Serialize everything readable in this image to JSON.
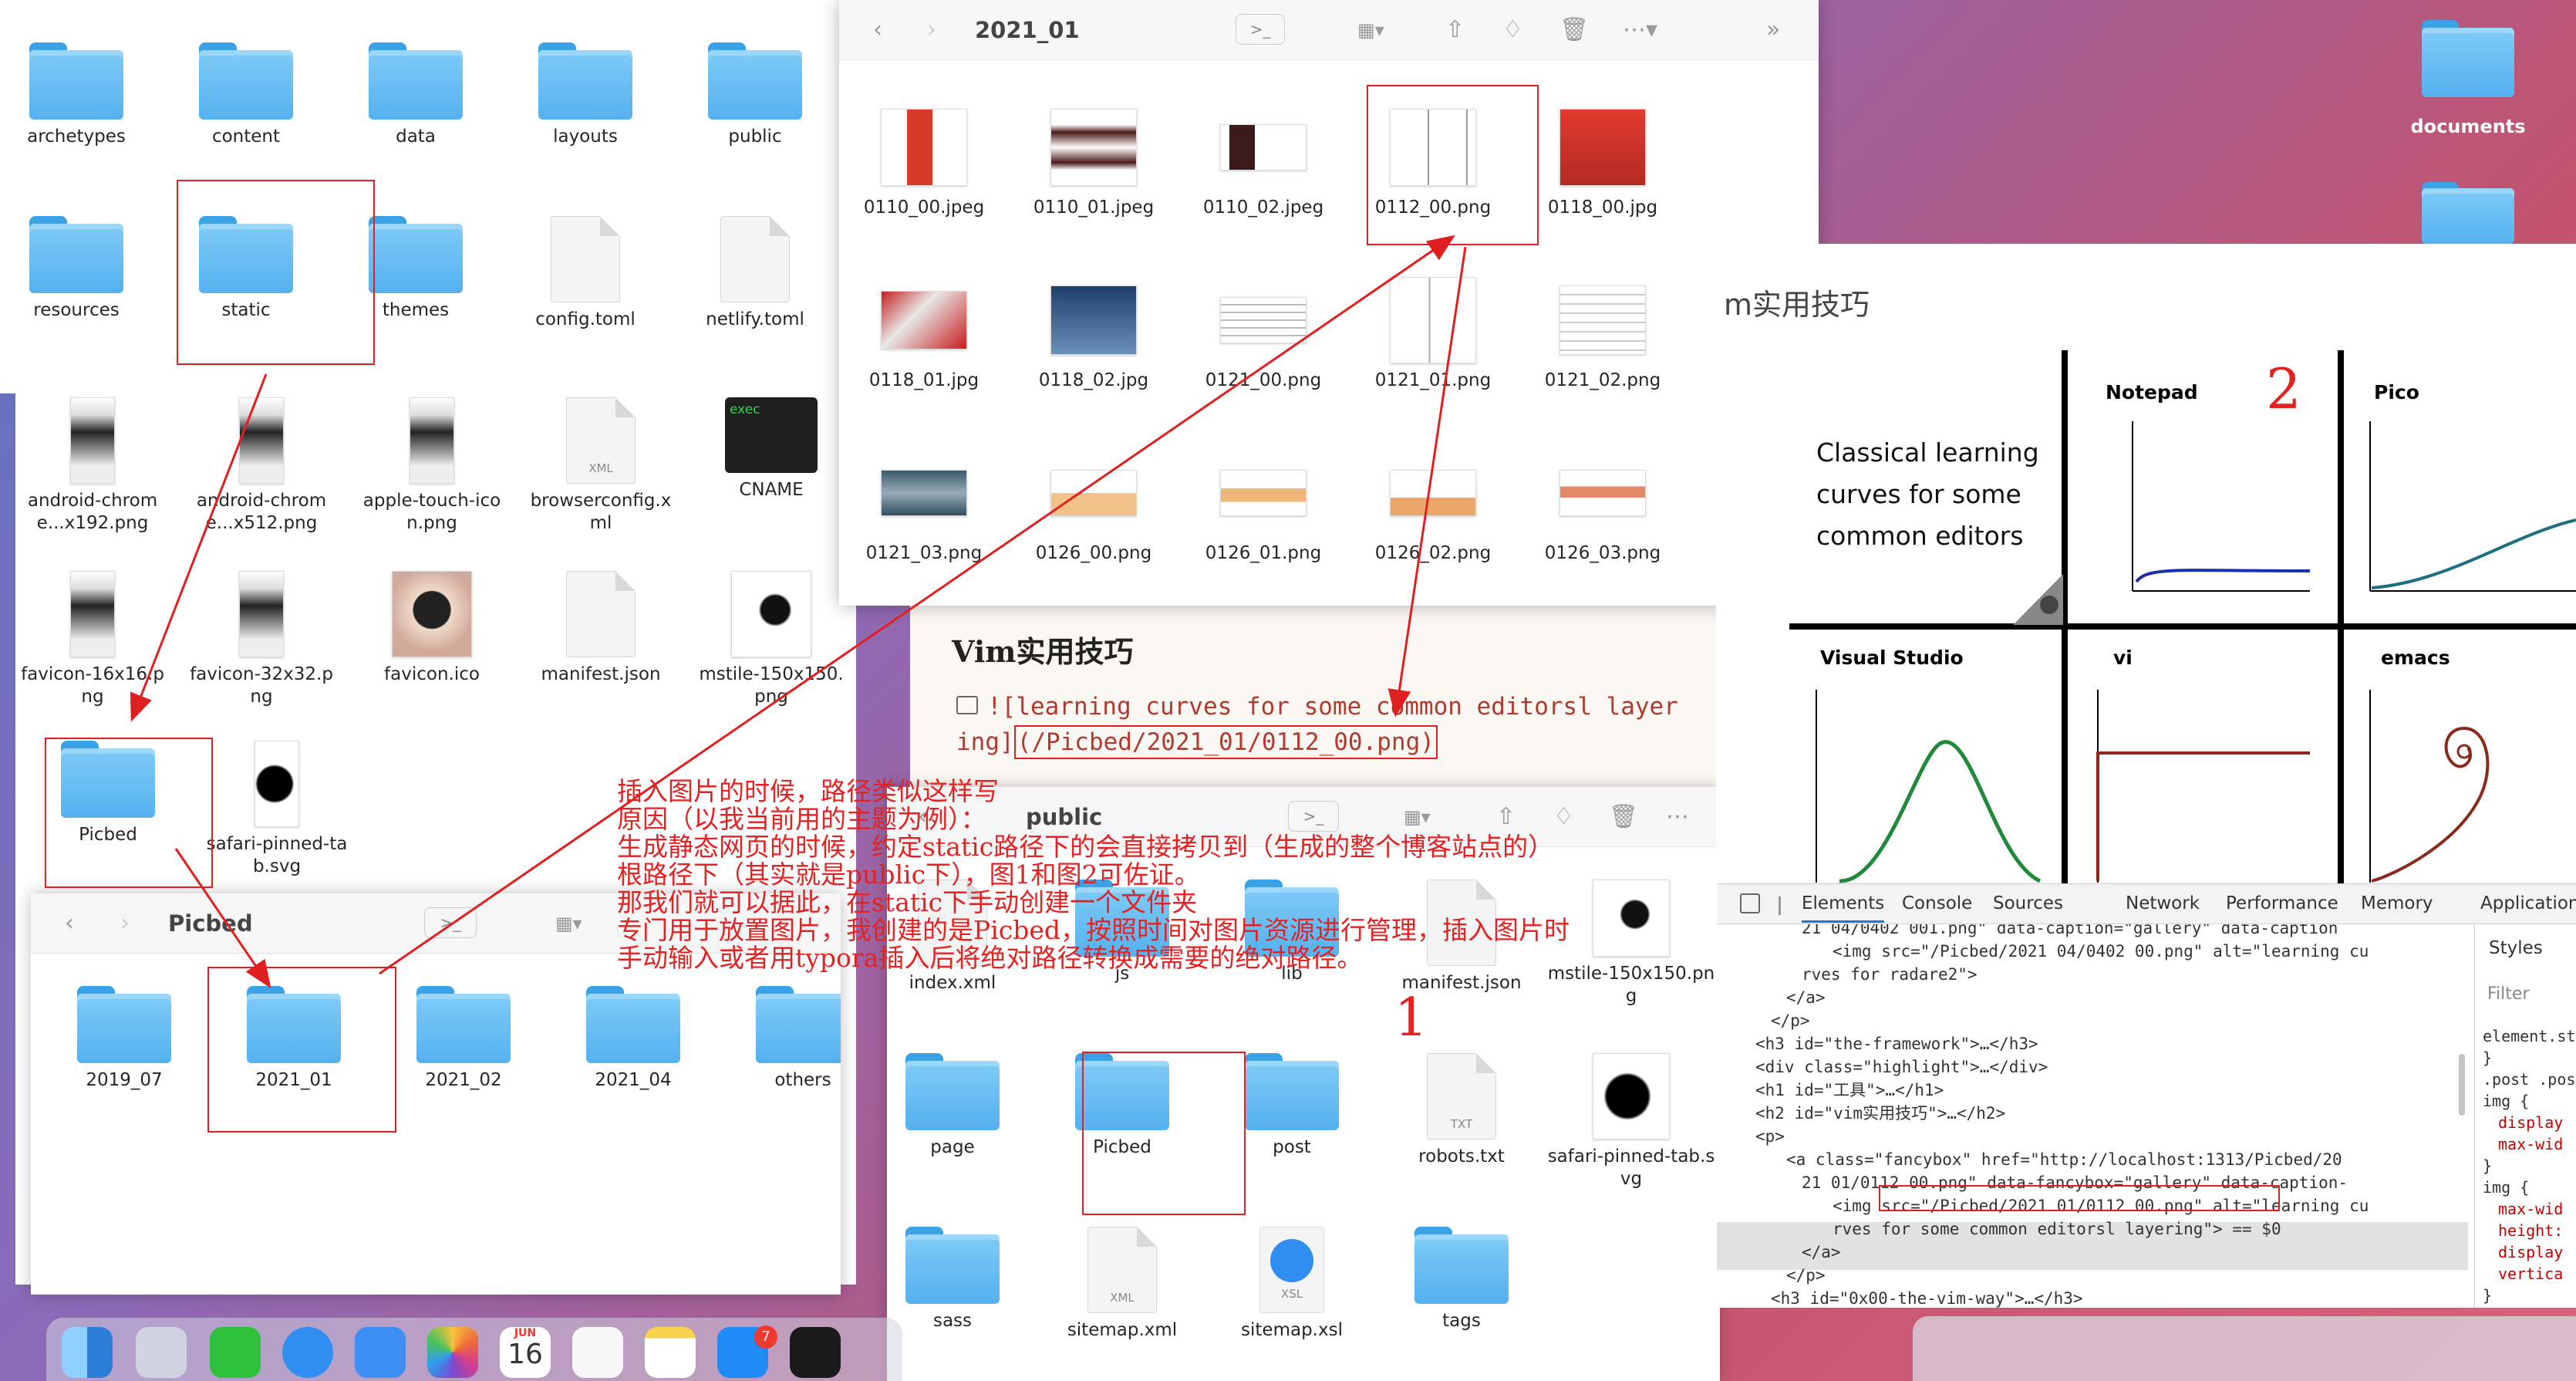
{
  "desktop": {
    "icon_label": "documents"
  },
  "win_root": {
    "items": [
      {
        "label": "archetypes",
        "kind": "folder"
      },
      {
        "label": "content",
        "kind": "folder"
      },
      {
        "label": "data",
        "kind": "folder"
      },
      {
        "label": "layouts",
        "kind": "folder"
      },
      {
        "label": "public",
        "kind": "folder"
      },
      {
        "label": "resources",
        "kind": "folder"
      },
      {
        "label": "static",
        "kind": "folder"
      },
      {
        "label": "themes",
        "kind": "folder"
      },
      {
        "label": "config.toml",
        "kind": "doc"
      },
      {
        "label": "netlify.toml",
        "kind": "doc"
      }
    ]
  },
  "win_static": {
    "items": [
      {
        "label": "android-chrome...x192.png"
      },
      {
        "label": "android-chrome...x512.png"
      },
      {
        "label": "apple-touch-icon.png"
      },
      {
        "label": "browserconfig.xml",
        "ext": "XML"
      },
      {
        "label": "CNAME",
        "exec": "exec"
      },
      {
        "label": "favicon-16x16.png"
      },
      {
        "label": "favicon-32x32.png"
      },
      {
        "label": "favicon.ico"
      },
      {
        "label": "manifest.json"
      },
      {
        "label": "mstile-150x150.png"
      },
      {
        "label": "Picbed"
      },
      {
        "label": "safari-pinned-tab.svg"
      }
    ]
  },
  "win_picbed": {
    "title": "Picbed",
    "items": [
      "2019_07",
      "2021_01",
      "2021_02",
      "2021_04",
      "others"
    ]
  },
  "win_2021": {
    "title": "2021_01",
    "items": [
      "0110_00.jpeg",
      "0110_01.jpeg",
      "0110_02.jpeg",
      "0112_00.png",
      "0118_00.jpg",
      "0118_01.jpg",
      "0118_02.jpg",
      "0121_00.png",
      "0121_01.png",
      "0121_02.png",
      "0121_03.png",
      "0126_00.png",
      "0126_01.png",
      "0126_02.png",
      "0126_03.png"
    ]
  },
  "editor": {
    "heading": "Vim实用技巧",
    "line1": "![learning curves for some common editorsl layer",
    "line2_prefix": "ing]",
    "line2_path": "(/Picbed/2021_01/0112_00.png)"
  },
  "win_public": {
    "title": "public",
    "items": [
      {
        "label": "index.xml"
      },
      {
        "label": "js"
      },
      {
        "label": "lib"
      },
      {
        "label": "manifest.json"
      },
      {
        "label": "mstile-150x150.png"
      },
      {
        "label": "page"
      },
      {
        "label": "Picbed"
      },
      {
        "label": "post"
      },
      {
        "label": "robots.txt",
        "ext": "TXT"
      },
      {
        "label": "safari-pinned-tab.svg"
      },
      {
        "label": "sass"
      },
      {
        "label": "sitemap.xml",
        "ext": "XML"
      },
      {
        "label": "sitemap.xsl",
        "ext": "XSL"
      },
      {
        "label": "tags"
      }
    ]
  },
  "browser": {
    "page_heading": "m实用技巧",
    "curves_caption": [
      "Classical learning",
      "curves for some",
      "common editors"
    ],
    "panels": [
      "Notepad",
      "Pico",
      "Visual Studio",
      "vi",
      "emacs"
    ],
    "devtools": {
      "tabs": [
        "Elements",
        "Console",
        "Sources",
        "Network",
        "Performance",
        "Memory",
        "Application"
      ],
      "styles_tab": "Styles",
      "filter_placeholder": "Filter",
      "styles_lines": [
        "element.st",
        "}",
        ".post .pos",
        "img {",
        "display",
        "max-wid",
        "}",
        "img {",
        "max-wid",
        "height:",
        "display",
        "vertica",
        "}"
      ],
      "code": [
        "21 04/0402 001.png\" data-caption=\"gallery\" data-caption",
        "<img src=\"/Picbed/2021 04/0402 00.png\" alt=\"learning cu",
        "rves for radare2\">",
        "</a>",
        "</p>",
        "<h3 id=\"the-framework\">…</h3>",
        "<div class=\"highlight\">…</div>",
        "<h1 id=\"工具\">…</h1>",
        "<h2 id=\"vim实用技巧\">…</h2>",
        "<p>",
        "<a class=\"fancybox\" href=\"http://localhost:1313/Picbed/20",
        "21 01/0112 00.png\" data-fancybox=\"gallery\" data-caption-",
        "<img src=\"/Picbed/2021 01/0112 00.png\" alt=\"learning cu",
        "rves for some common editorsl layering\"> == $0",
        "</a>",
        "</p>",
        "<h3 id=\"0x00-the-vim-way\">…</h3>"
      ]
    }
  },
  "annotation": {
    "lines": [
      "插入图片的时候，路径类似这样写",
      "原因（以我当前用的主题为例）：",
      "生成静态网页的时候，约定static路径下的会直接拷贝到（生成的整个博客站点的）",
      "根路径下（其实就是public下），图1和图2可佐证。",
      "那我们就可以据此，在static下手动创建一个文件夹",
      "专门用于放置图片，我创建的是Picbed，按照时间对图片资源进行管理，插入图片时",
      "手动输入或者用typora插入后将绝对路径转换成需要的绝对路径。"
    ],
    "marker_1": "1",
    "marker_2": "2"
  },
  "dock": {
    "calendar_month": "JUN",
    "calendar_day": "16",
    "appstore_badge": "7"
  }
}
